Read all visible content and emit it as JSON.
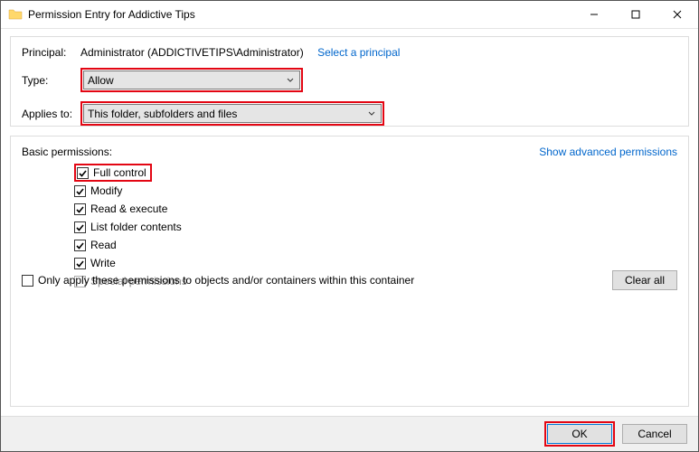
{
  "window": {
    "title": "Permission Entry for Addictive Tips"
  },
  "principal": {
    "label": "Principal:",
    "value": "Administrator (ADDICTIVETIPS\\Administrator)",
    "select_link": "Select a principal"
  },
  "type_row": {
    "label": "Type:",
    "value": "Allow"
  },
  "applies_row": {
    "label": "Applies to:",
    "value": "This folder, subfolders and files"
  },
  "basic": {
    "label": "Basic permissions:",
    "advanced_link": "Show advanced permissions",
    "permissions": {
      "full_control": "Full control",
      "modify": "Modify",
      "read_execute": "Read & execute",
      "list_folder": "List folder contents",
      "read": "Read",
      "write": "Write",
      "special": "Special permissions"
    }
  },
  "only_apply": "Only apply these permissions to objects and/or containers within this container",
  "buttons": {
    "clear_all": "Clear all",
    "ok": "OK",
    "cancel": "Cancel"
  }
}
